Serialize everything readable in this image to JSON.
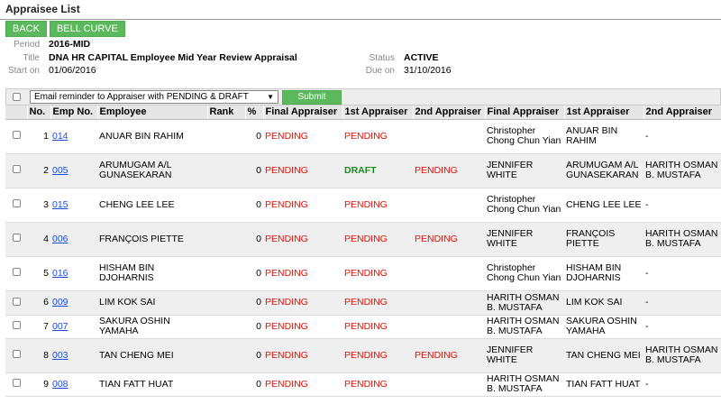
{
  "page": {
    "title": "Appraisee List"
  },
  "buttons": {
    "back": "BACK",
    "bell_curve": "BELL CURVE"
  },
  "info": {
    "period_label": "Period",
    "period": "2016-MID",
    "title_label": "Title",
    "title": "DNA HR CAPITAL Employee Mid Year Review Appraisal",
    "start_label": "Start on",
    "start": "01/06/2016",
    "status_label": "Status",
    "status": "ACTIVE",
    "due_label": "Due on",
    "due": "31/10/2016"
  },
  "toolbar": {
    "reminder_option": "Email reminder to Appraiser with PENDING & DRAFT",
    "submit_label": "Submit"
  },
  "table": {
    "headers": [
      "No.",
      "Emp No.",
      "Employee",
      "Rank",
      "%",
      "Final Appraiser",
      "1st Appraiser",
      "2nd Appraiser",
      "Final Appraiser",
      "1st Appraiser",
      "2nd Appraiser"
    ],
    "rows": [
      {
        "no": "1",
        "emp_no": "014",
        "employee": "ANUAR BIN RAHIM",
        "rank": "",
        "pct": "0",
        "final_status": "PENDING",
        "first_status": "PENDING",
        "second_status": "",
        "final_name": "Christopher Chong Chun Yian",
        "first_name": "ANUAR BIN RAHIM",
        "second_name": "-"
      },
      {
        "no": "2",
        "emp_no": "005",
        "employee": "ARUMUGAM A/L GUNASEKARAN",
        "rank": "",
        "pct": "0",
        "final_status": "PENDING",
        "first_status": "DRAFT",
        "second_status": "PENDING",
        "final_name": "JENNIFER WHITE",
        "first_name": "ARUMUGAM A/L GUNASEKARAN",
        "second_name": "HARITH OSMAN B. MUSTAFA"
      },
      {
        "no": "3",
        "emp_no": "015",
        "employee": "CHENG LEE LEE",
        "rank": "",
        "pct": "0",
        "final_status": "PENDING",
        "first_status": "PENDING",
        "second_status": "",
        "final_name": "Christopher Chong Chun Yian",
        "first_name": "CHENG LEE LEE",
        "second_name": "-"
      },
      {
        "no": "4",
        "emp_no": "006",
        "employee": "FRANÇOIS PIETTE",
        "rank": "",
        "pct": "0",
        "final_status": "PENDING",
        "first_status": "PENDING",
        "second_status": "PENDING",
        "final_name": "JENNIFER WHITE",
        "first_name": "FRANÇOIS PIETTE",
        "second_name": "HARITH OSMAN B. MUSTAFA"
      },
      {
        "no": "5",
        "emp_no": "016",
        "employee": "HISHAM BIN DJOHARNIS",
        "rank": "",
        "pct": "0",
        "final_status": "PENDING",
        "first_status": "PENDING",
        "second_status": "",
        "final_name": "Christopher Chong Chun Yian",
        "first_name": "HISHAM BIN DJOHARNIS",
        "second_name": "-"
      },
      {
        "no": "6",
        "emp_no": "009",
        "employee": "LIM KOK SAI",
        "rank": "",
        "pct": "0",
        "final_status": "PENDING",
        "first_status": "PENDING",
        "second_status": "",
        "final_name": "HARITH OSMAN B. MUSTAFA",
        "first_name": "LIM KOK SAI",
        "second_name": "-"
      },
      {
        "no": "7",
        "emp_no": "007",
        "employee": "SAKURA OSHIN YAMAHA",
        "rank": "",
        "pct": "0",
        "final_status": "PENDING",
        "first_status": "PENDING",
        "second_status": "",
        "final_name": "HARITH OSMAN B. MUSTAFA",
        "first_name": "SAKURA OSHIN YAMAHA",
        "second_name": "-"
      },
      {
        "no": "8",
        "emp_no": "003",
        "employee": "TAN CHENG MEI",
        "rank": "",
        "pct": "0",
        "final_status": "PENDING",
        "first_status": "PENDING",
        "second_status": "PENDING",
        "final_name": "JENNIFER WHITE",
        "first_name": "TAN CHENG MEI",
        "second_name": "HARITH OSMAN B. MUSTAFA"
      },
      {
        "no": "9",
        "emp_no": "008",
        "employee": "TIAN FATT HUAT",
        "rank": "",
        "pct": "0",
        "final_status": "PENDING",
        "first_status": "PENDING",
        "second_status": "",
        "final_name": "HARITH OSMAN B. MUSTAFA",
        "first_name": "TIAN FATT HUAT",
        "second_name": "-"
      }
    ]
  },
  "colors": {
    "button": "#5cb85c",
    "pending": "#d9140a",
    "draft": "#1f8a1f",
    "link": "#1a4ed8"
  }
}
